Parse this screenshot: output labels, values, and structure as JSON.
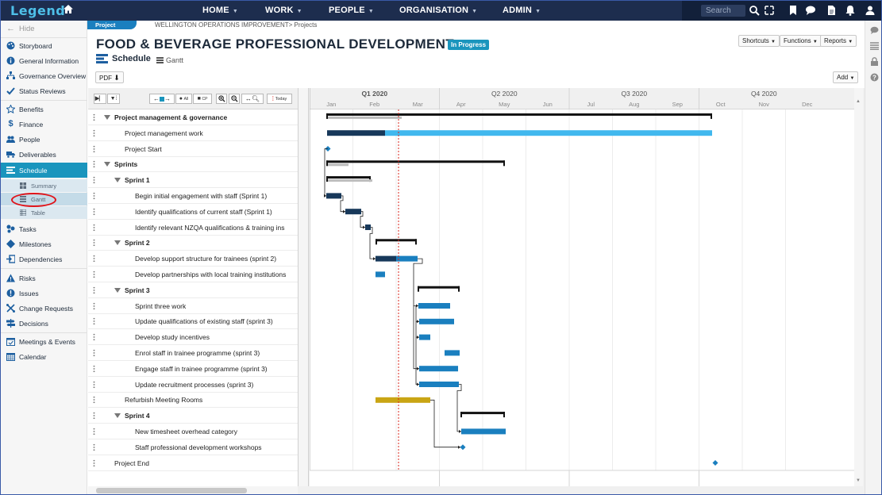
{
  "app": {
    "logo": "Legend"
  },
  "nav": {
    "items": [
      {
        "label": "HOME"
      },
      {
        "label": "WORK"
      },
      {
        "label": "PEOPLE"
      },
      {
        "label": "ORGANISATION"
      },
      {
        "label": "ADMIN"
      }
    ],
    "search_placeholder": "Search"
  },
  "sidebar": {
    "hide_label": "Hide",
    "items": [
      {
        "label": "Storyboard",
        "icon": "palette-icon"
      },
      {
        "label": "General Information",
        "icon": "info-icon"
      },
      {
        "label": "Governance Overview",
        "icon": "sitemap-icon"
      },
      {
        "label": "Status Reviews",
        "icon": "check-icon"
      },
      {
        "label": "Benefits",
        "icon": "star-icon"
      },
      {
        "label": "Finance",
        "icon": "dollar-icon"
      },
      {
        "label": "People",
        "icon": "users-icon"
      },
      {
        "label": "Deliverables",
        "icon": "truck-icon"
      },
      {
        "label": "Schedule",
        "icon": "schedule-icon"
      },
      {
        "label": "Tasks",
        "icon": "tasks-icon"
      },
      {
        "label": "Milestones",
        "icon": "diamond-icon"
      },
      {
        "label": "Dependencies",
        "icon": "dependency-icon"
      },
      {
        "label": "Risks",
        "icon": "warning-icon"
      },
      {
        "label": "Issues",
        "icon": "alert-icon"
      },
      {
        "label": "Change Requests",
        "icon": "change-icon"
      },
      {
        "label": "Decisions",
        "icon": "signpost-icon"
      },
      {
        "label": "Meetings & Events",
        "icon": "calendar-check-icon"
      },
      {
        "label": "Calendar",
        "icon": "calendar-icon"
      }
    ],
    "schedule_sub": [
      {
        "label": "Summary"
      },
      {
        "label": "Gantt"
      },
      {
        "label": "Table"
      }
    ]
  },
  "header": {
    "tab": "Project",
    "breadcrumb": "WELLINGTON OPERATIONS IMPROVEMENT> Projects",
    "title": "FOOD & BEVERAGE PROFESSIONAL DEVELOPMENT",
    "status": "In Progress",
    "buttons": {
      "shortcuts": "Shortcuts",
      "functions": "Functions",
      "reports": "Reports"
    },
    "section": "Schedule",
    "view": "Gantt",
    "pdf": "PDF",
    "add": "Add"
  },
  "toolbar": {
    "all": "All",
    "cp": "CP",
    "today": "Today"
  },
  "timeline": {
    "quarters": [
      "Q1 2020",
      "Q2 2020",
      "Q3 2020",
      "Q4 2020"
    ],
    "months": [
      "Jan",
      "Feb",
      "Mar",
      "Apr",
      "May",
      "Jun",
      "Jul",
      "Aug",
      "Sep",
      "Oct",
      "Nov",
      "Dec"
    ]
  },
  "tasks": [
    {
      "label": "Project management & governance",
      "level": 0,
      "group": true,
      "bold": true
    },
    {
      "label": "Project management work",
      "level": 1
    },
    {
      "label": "Project Start",
      "level": 1
    },
    {
      "label": "Sprints",
      "level": 0,
      "group": true,
      "bold": true
    },
    {
      "label": "Sprint 1",
      "level": 1,
      "group": true,
      "bold": true
    },
    {
      "label": "Begin initial engagement with staff (Sprint 1)",
      "level": 2
    },
    {
      "label": "Identify qualifications of current staff (Sprint 1)",
      "level": 2
    },
    {
      "label": "Identify relevant NZQA qualifications & training ins",
      "level": 2
    },
    {
      "label": "Sprint 2",
      "level": 1,
      "group": true,
      "bold": true
    },
    {
      "label": "Develop support structure for trainees (sprint 2)",
      "level": 2
    },
    {
      "label": "Develop partnerships with local training institutions",
      "level": 2
    },
    {
      "label": "Sprint 3",
      "level": 1,
      "group": true,
      "bold": true
    },
    {
      "label": "Sprint three work",
      "level": 2
    },
    {
      "label": "Update qualifications of existing staff (sprint 3)",
      "level": 2
    },
    {
      "label": "Develop study incentives",
      "level": 2
    },
    {
      "label": "Enrol staff in trainee programme (sprint 3)",
      "level": 2
    },
    {
      "label": "Engage staff in trainee programme (sprint 3)",
      "level": 2
    },
    {
      "label": "Update recruitment processes (sprint 3)",
      "level": 2
    },
    {
      "label": "Refurbish Meeting Rooms",
      "level": 1
    },
    {
      "label": "Sprint 4",
      "level": 1,
      "group": true,
      "bold": true
    },
    {
      "label": "New timesheet overhead category",
      "level": 2
    },
    {
      "label": "Staff professional development workshops",
      "level": 2
    },
    {
      "label": "Project End",
      "level": 0
    }
  ],
  "colors": {
    "nav_bg": "#1d2d4e",
    "accent": "#1a95bd",
    "bar_blue": "#1a7fbf",
    "bar_lightblue": "#41b8ee",
    "bar_dark": "#17385a",
    "bar_gold": "#c9a514",
    "summary": "#111111",
    "today_line": "#d9241b",
    "highlight_circle": "#e0141a"
  }
}
